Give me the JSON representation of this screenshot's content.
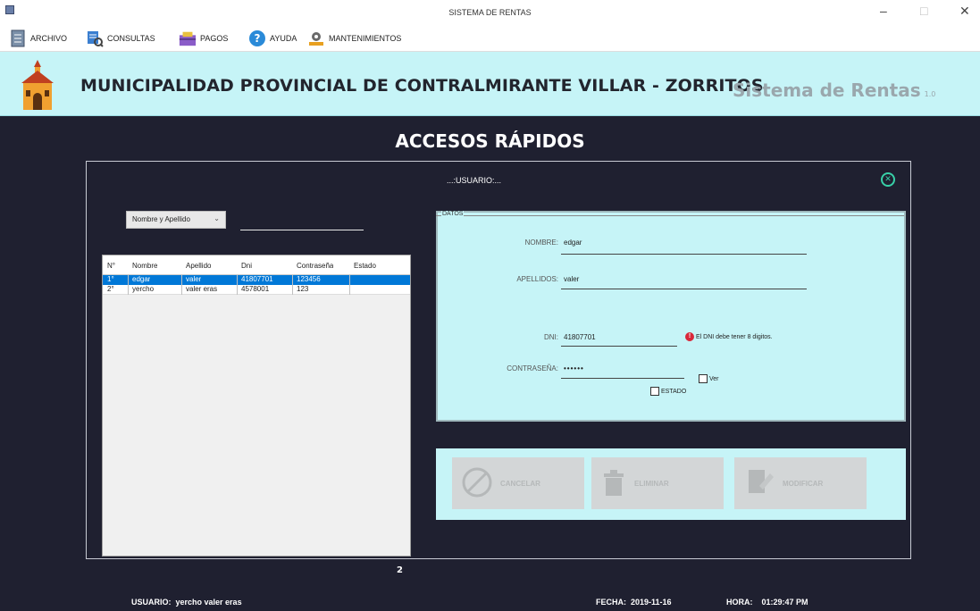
{
  "window": {
    "title": "SISTEMA DE RENTAS",
    "minimize": "–",
    "maximize": "□",
    "close": "✕"
  },
  "menu": [
    {
      "label": "ARCHIVO",
      "icon": "file-icon"
    },
    {
      "label": "CONSULTAS",
      "icon": "consult-icon"
    },
    {
      "label": "PAGOS",
      "icon": "payments-icon"
    },
    {
      "label": "AYUDA",
      "icon": "help-icon"
    },
    {
      "label": "MANTENIMIENTOS",
      "icon": "maintenance-icon"
    }
  ],
  "header": {
    "org": "MUNICIPALIDAD PROVINCIAL DE CONTRALMIRANTE VILLAR - ZORRITOS",
    "system": "Sistema de Rentas",
    "version": "1.0"
  },
  "page_title": "ACCESOS RÁPIDOS",
  "panel": {
    "heading": "...:USUARIO:...",
    "close_icon": "✕",
    "filter": {
      "selected": "Nombre y Apellido",
      "arrow": "⌄"
    },
    "table": {
      "columns": [
        "N°",
        "Nombre",
        "Apellido",
        "Dni",
        "Contraseña",
        "Estado"
      ],
      "rows": [
        [
          "1°",
          "edgar",
          "valer",
          "41807701",
          "123456",
          ""
        ],
        [
          "2°",
          "yercho",
          "valer eras",
          "4578001",
          "123",
          ""
        ]
      ],
      "count": "2"
    },
    "form": {
      "legend": "DATOS",
      "nombre_label": "NOMBRE:",
      "nombre_value": "edgar",
      "apellidos_label": "APELLIDOS:",
      "apellidos_value": "valer",
      "dni_label": "DNI:",
      "dni_value": "41807701",
      "dni_warning": "El DNI debe tener 8 digitos.",
      "password_label": "CONTRASEÑA:",
      "password_value": "••••••",
      "ver_label": "Ver",
      "estado_label": "ESTADO"
    },
    "actions": [
      {
        "label": "CANCELAR",
        "icon": "cancel-icon"
      },
      {
        "label": "ELIMINAR",
        "icon": "trash-icon"
      },
      {
        "label": "MODIFICAR",
        "icon": "modify-icon"
      }
    ]
  },
  "status": {
    "user_label": "USUARIO:",
    "user_value": "yercho valer eras",
    "date_label": "FECHA:",
    "date_value": "2019-11-16",
    "time_label": "HORA:",
    "time_value": "01:29:47 PM"
  },
  "colors": {
    "background": "#1f2030",
    "accent_cyan": "#c6f4f7",
    "selection": "#0078d7",
    "warning": "#d8283a"
  }
}
